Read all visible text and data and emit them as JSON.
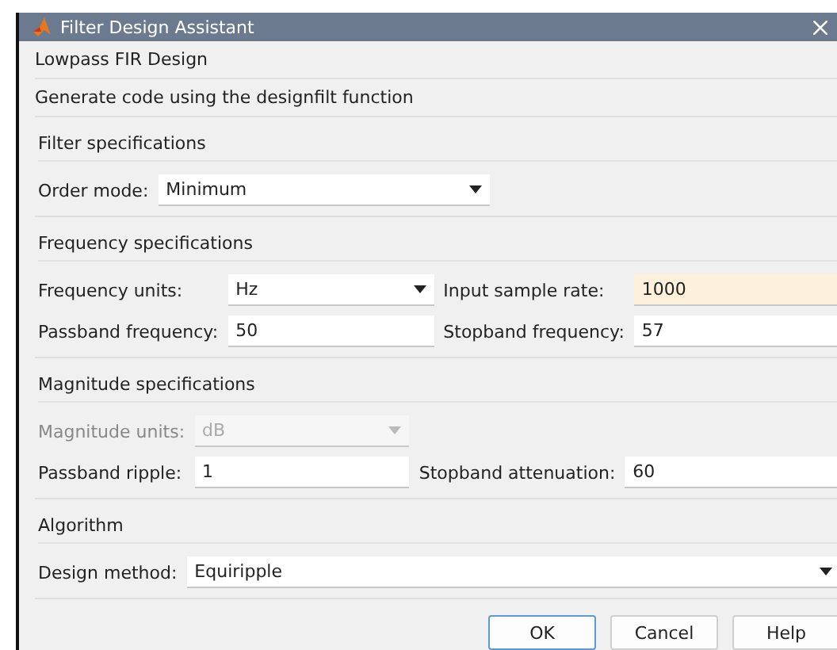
{
  "window": {
    "title": "Filter Design Assistant"
  },
  "header": {
    "title": "Lowpass FIR Design",
    "subtitle": "Generate code using the designfilt function"
  },
  "sections": [
    {
      "title": "Filter specifications",
      "kind": "grid",
      "rows": [
        [
          {
            "label": "Order mode:",
            "kind": "dropdown",
            "value": "Minimum",
            "disabled": false,
            "highlighted": false
          }
        ]
      ]
    },
    {
      "title": "Frequency specifications",
      "kind": "grid",
      "rows": [
        [
          {
            "label": "Frequency units:",
            "kind": "dropdown",
            "value": "Hz",
            "disabled": false,
            "highlighted": false
          },
          {
            "label": "Input sample rate:",
            "kind": "input",
            "value": "1000",
            "disabled": false,
            "highlighted": true
          }
        ],
        [
          {
            "label": "Passband frequency:",
            "kind": "input",
            "value": "50",
            "disabled": false,
            "highlighted": false
          },
          {
            "label": "Stopband frequency:",
            "kind": "input",
            "value": "57",
            "disabled": false,
            "highlighted": false
          }
        ]
      ]
    },
    {
      "title": "Magnitude specifications",
      "kind": "grid",
      "rows": [
        [
          {
            "label": "Magnitude units:",
            "kind": "dropdown",
            "value": "dB",
            "disabled": true,
            "highlighted": false
          }
        ],
        [
          {
            "label": "Passband ripple:",
            "kind": "input",
            "value": "1",
            "disabled": false,
            "highlighted": false
          },
          {
            "label": "Stopband attenuation:",
            "kind": "input",
            "value": "60",
            "disabled": false,
            "highlighted": false
          }
        ]
      ]
    },
    {
      "title": "Algorithm",
      "kind": "wide",
      "rows": [
        [
          {
            "label": "Design method:",
            "kind": "dropdown",
            "value": "Equiripple",
            "disabled": false,
            "highlighted": false
          }
        ]
      ]
    }
  ],
  "buttons": [
    {
      "label": "OK",
      "default": true
    },
    {
      "label": "Cancel",
      "default": false
    },
    {
      "label": "Help",
      "default": false
    }
  ]
}
